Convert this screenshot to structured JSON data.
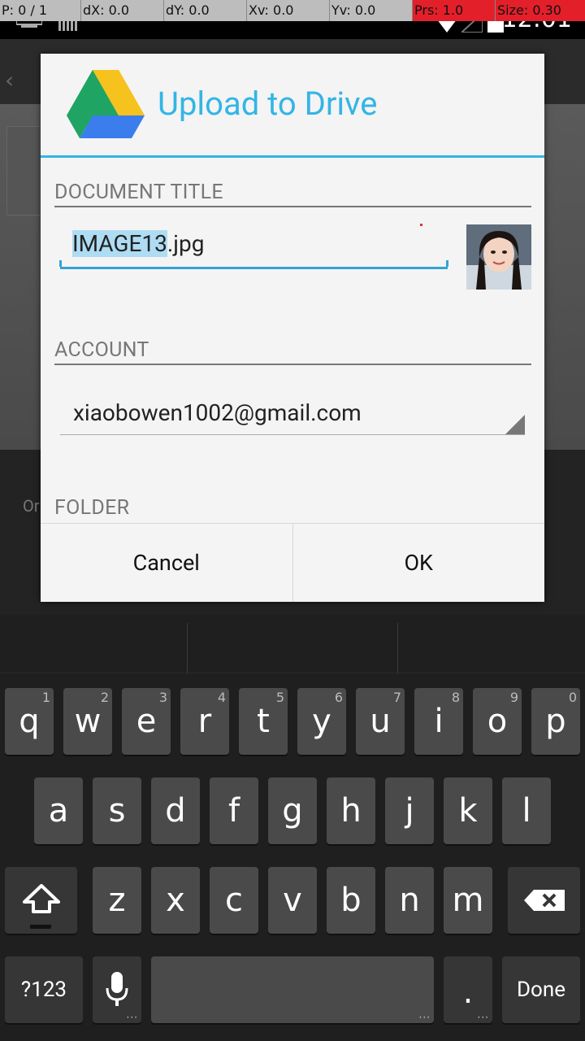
{
  "debug_overlay": {
    "p": "P: 0 / 1",
    "dx": "dX: 0.0",
    "dy": "dY: 0.0",
    "xv": "Xv: 0.0",
    "yv": "Yv: 0.0",
    "prs": "Prs: 1.0",
    "size": "Size: 0.30"
  },
  "status_bar": {
    "time": "12:01"
  },
  "background": {
    "lower_text": "Or"
  },
  "dialog": {
    "title": "Upload to Drive",
    "document_title_label": "DOCUMENT TITLE",
    "document_title": {
      "selected": "IMAGE13",
      "rest": ".jpg"
    },
    "account_label": "ACCOUNT",
    "account_value": "xiaobowen1002@gmail.com",
    "folder_label": "FOLDER",
    "cancel_label": "Cancel",
    "ok_label": "OK"
  },
  "keyboard": {
    "row1": [
      {
        "k": "q",
        "h": "1"
      },
      {
        "k": "w",
        "h": "2"
      },
      {
        "k": "e",
        "h": "3"
      },
      {
        "k": "r",
        "h": "4"
      },
      {
        "k": "t",
        "h": "5"
      },
      {
        "k": "y",
        "h": "6"
      },
      {
        "k": "u",
        "h": "7"
      },
      {
        "k": "i",
        "h": "8"
      },
      {
        "k": "o",
        "h": "9"
      },
      {
        "k": "p",
        "h": "0"
      }
    ],
    "row2": [
      "a",
      "s",
      "d",
      "f",
      "g",
      "h",
      "j",
      "k",
      "l"
    ],
    "row3": [
      "z",
      "x",
      "c",
      "v",
      "b",
      "n",
      "m"
    ],
    "symbols_label": "?123",
    "period_label": ".",
    "done_label": "Done"
  },
  "colors": {
    "accent": "#33b5e5"
  }
}
